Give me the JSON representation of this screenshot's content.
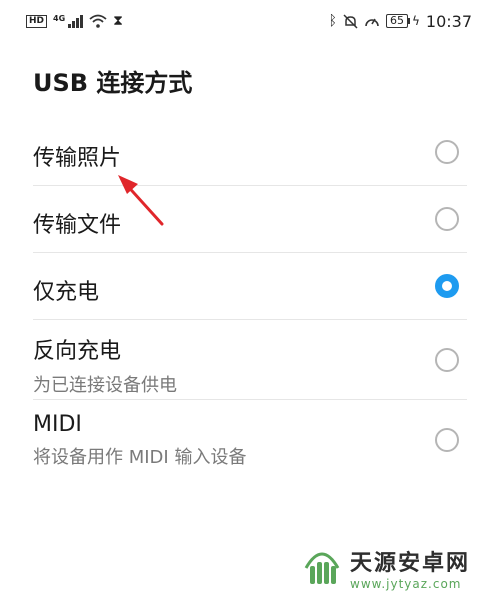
{
  "status": {
    "hd": "HD",
    "net": "4G",
    "battery": "65",
    "time": "10:37"
  },
  "icons": {
    "signal": "signal-icon",
    "wifi": "wifi-icon",
    "hourglass": "hourglass-icon",
    "bluetooth": "bluetooth-icon",
    "mute": "bell-off-icon",
    "speed": "gauge-icon",
    "charging": "bolt-icon"
  },
  "page": {
    "title": "USB 连接方式"
  },
  "options": [
    {
      "label": "传输照片",
      "sub": "",
      "selected": false
    },
    {
      "label": "传输文件",
      "sub": "",
      "selected": false
    },
    {
      "label": "仅充电",
      "sub": "",
      "selected": true
    },
    {
      "label": "反向充电",
      "sub": "为已连接设备供电",
      "selected": false
    },
    {
      "label": "MIDI",
      "sub": "将设备用作 MIDI 输入设备",
      "selected": false
    }
  ],
  "colors": {
    "accent": "#1e9bf0",
    "annotation_arrow": "#e0262b",
    "watermark_green": "#5aa65a"
  },
  "watermark": {
    "name": "天源安卓网",
    "url": "www.jytyaz.com"
  }
}
